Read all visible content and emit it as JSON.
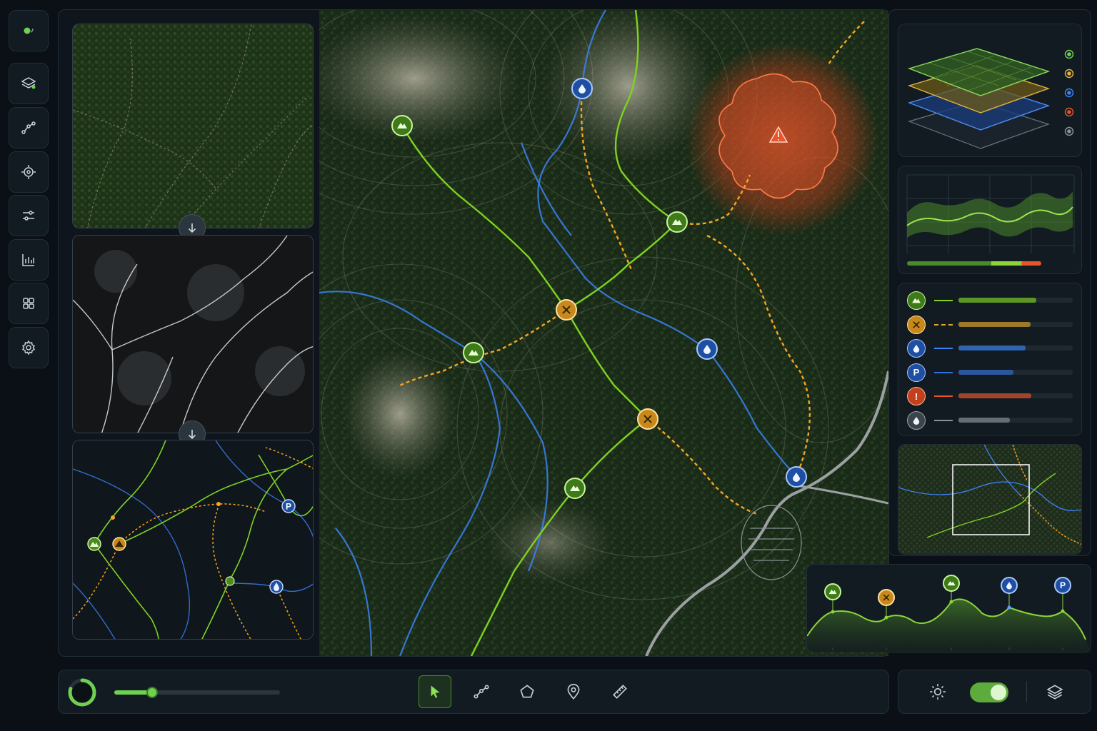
{
  "colors": {
    "trail": "#7ed321",
    "route": "#f5a623",
    "water": "#3b82f6",
    "hazard": "#e8552b",
    "neutral": "#8a939b",
    "accent": "#6fd152"
  },
  "icons": {
    "rail": [
      "logo-icon",
      "layers-stack-icon",
      "route-nodes-icon",
      "target-icon",
      "sliders-icon",
      "chart-bars-icon",
      "grid-apps-icon",
      "settings-gear-icon"
    ],
    "tools": [
      "pointer-icon",
      "path-draw-icon",
      "polygon-icon",
      "location-pin-icon",
      "ruler-icon"
    ],
    "right": [
      "sun-icon",
      "layers-icon"
    ]
  },
  "legend": [
    {
      "type": "peak",
      "icon": "mountain-icon",
      "color": "#7ed321",
      "level": 0.68
    },
    {
      "type": "junction",
      "icon": "junction-icon",
      "color": "#e0a52a",
      "level": 0.63
    },
    {
      "type": "water",
      "icon": "water-drop-icon",
      "color": "#3b82f6",
      "level": 0.59
    },
    {
      "type": "parking",
      "glyph": "P",
      "icon": "parking-icon",
      "color": "#2f6fd8",
      "level": 0.48
    },
    {
      "type": "hazard",
      "glyph": "!",
      "icon": "hazard-icon",
      "color": "#e8552b",
      "level": 0.64
    },
    {
      "type": "other",
      "icon": "drop-grey-icon",
      "color": "#8a939b",
      "level": 0.45
    }
  ],
  "layer_dots": [
    "#6fd152",
    "#e0b53a",
    "#3b82f6",
    "#e8552b",
    "#8a939b"
  ],
  "profile_markers": [
    {
      "icon": "mountain-icon",
      "color": "#7ed321"
    },
    {
      "icon": "junction-icon",
      "color": "#e0a52a"
    },
    {
      "icon": "mountain-icon",
      "color": "#7ed321"
    },
    {
      "icon": "water-drop-icon",
      "color": "#3b82f6"
    },
    {
      "icon": "parking-icon",
      "color": "#2f6fd8",
      "glyph": "P"
    }
  ],
  "map_markers": [
    {
      "icon": "mountain-icon",
      "color": "#7ed321"
    },
    {
      "icon": "water-drop-icon",
      "color": "#3b82f6"
    },
    {
      "icon": "mountain-icon",
      "color": "#7ed321"
    },
    {
      "icon": "junction-icon",
      "color": "#e0a52a"
    },
    {
      "icon": "mountain-icon",
      "color": "#7ed321"
    },
    {
      "icon": "water-drop-icon",
      "color": "#3b82f6"
    },
    {
      "icon": "junction-icon",
      "color": "#e0a52a"
    },
    {
      "icon": "mountain-icon",
      "color": "#7ed321"
    },
    {
      "icon": "water-drop-icon",
      "color": "#3b82f6"
    }
  ],
  "timeline": {
    "progress": 0.22
  },
  "loading": {
    "progress": 0.8
  },
  "toggle": {
    "on": true
  },
  "parking_glyph": "P"
}
